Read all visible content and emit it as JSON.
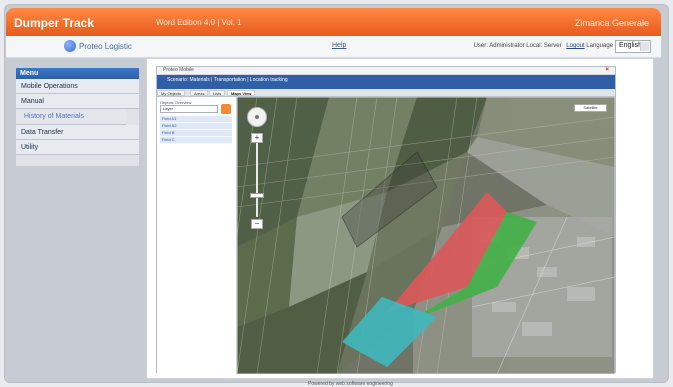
{
  "topbar": {
    "app_title": "Dumper Track",
    "version": "Word Edition 4.0 | Vol. 1",
    "client": "Zimanca Generale"
  },
  "header": {
    "logo_text": "Proteo Logistic",
    "help_link": "Help",
    "user_info": "User: Administrator  Local: Server",
    "logout": "Logout",
    "language_label": "Language",
    "language_value": "English"
  },
  "sidebar": {
    "title": "Menu",
    "items": [
      {
        "label": "Mobile Operations"
      },
      {
        "label": "Manual"
      },
      {
        "label": "History of Materials"
      },
      {
        "label": "Data Transfer"
      },
      {
        "label": "Utility"
      }
    ]
  },
  "inner": {
    "window_title": "Proteo Mobile",
    "blue_bar_text": "Scenario: Materials | Transportation | Location tracking",
    "tabs": [
      {
        "label": "My Objects"
      },
      {
        "label": "Areas"
      },
      {
        "label": "Lists"
      },
      {
        "label": "Maps View"
      }
    ],
    "left_panel": {
      "header": "Objects Overview",
      "select_value": "Layer",
      "items": [
        "Field A1",
        "Field A2",
        "Field B",
        "Field C"
      ]
    },
    "map": {
      "map_type_button": "Satellite",
      "zoom_in": "+",
      "zoom_out": "−"
    }
  },
  "footer": {
    "text": "Powered by web software engineering"
  },
  "colors": {
    "accent_orange": "#e85a1b",
    "menu_blue": "#2e5fa8",
    "field_red": "#d95959",
    "field_green": "#43b049",
    "field_cyan": "#3fb8be"
  }
}
